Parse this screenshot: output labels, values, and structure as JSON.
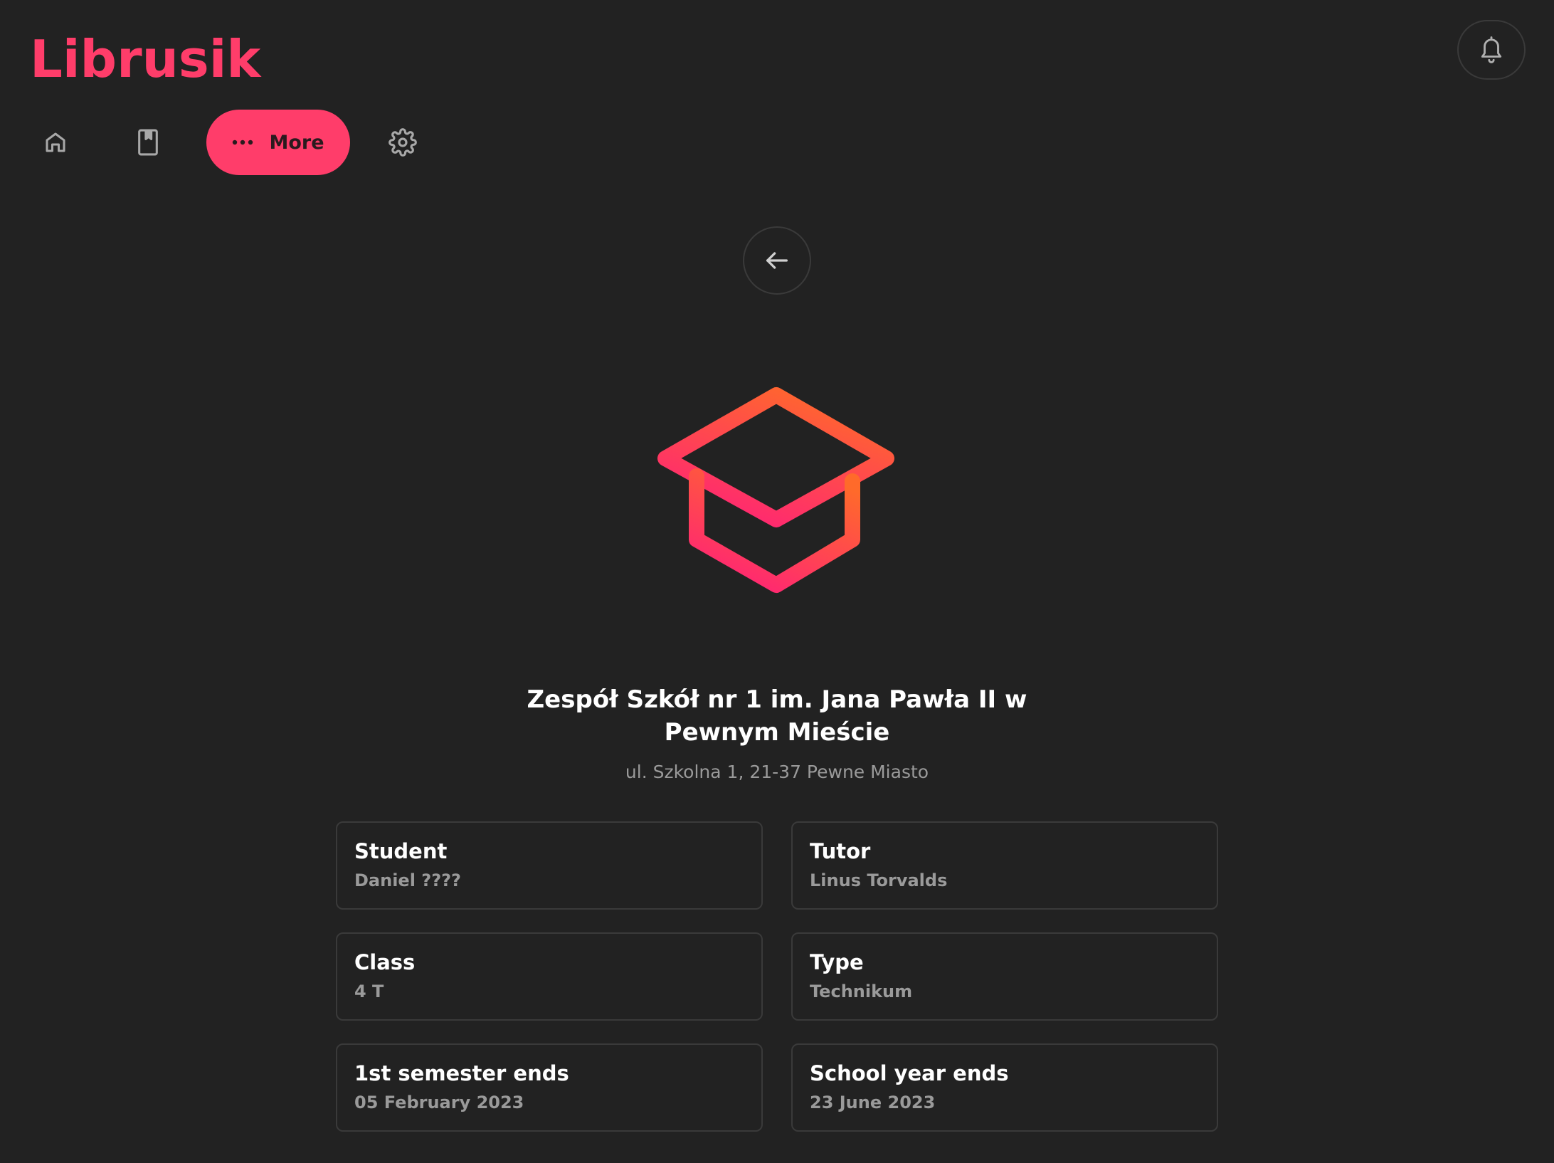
{
  "app": {
    "title": "Librusik",
    "accent_color": "#ff3d6a",
    "background_color": "#222222"
  },
  "header": {
    "notification_icon": "bell-icon"
  },
  "nav": {
    "items": [
      {
        "icon": "home-icon"
      },
      {
        "icon": "bookmark-icon"
      },
      {
        "icon": "more-dots-icon",
        "label": "More",
        "active": true
      },
      {
        "icon": "gear-icon"
      }
    ]
  },
  "back_icon": "arrow-left-icon",
  "hero_icon": "graduation-cap-icon",
  "school": {
    "name_line1": "Zespół Szkół nr 1 im. Jana Pawła II w",
    "name_line2": "Pewnym Mieście",
    "address": "ul. Szkolna 1, 21-37 Pewne Miasto"
  },
  "cards": [
    {
      "title": "Student",
      "value": "Daniel ????"
    },
    {
      "title": "Tutor",
      "value": "Linus Torvalds"
    },
    {
      "title": "Class",
      "value": "4 T"
    },
    {
      "title": "Type",
      "value": "Technikum"
    },
    {
      "title": "1st semester ends",
      "value": "05 February 2023"
    },
    {
      "title": "School year ends",
      "value": "23 June 2023"
    }
  ]
}
